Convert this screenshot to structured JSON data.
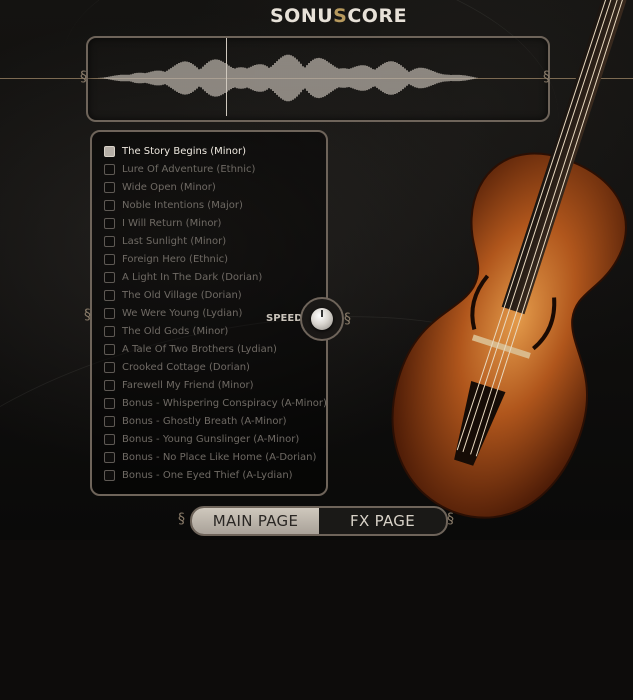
{
  "brand": {
    "logo_main": "SONU",
    "logo_s": "S",
    "logo_end": "CORE"
  },
  "presets": [
    {
      "label": "The Story Begins (Minor)",
      "selected": true
    },
    {
      "label": "Lure Of Adventure (Ethnic)",
      "selected": false
    },
    {
      "label": "Wide Open (Minor)",
      "selected": false
    },
    {
      "label": "Noble Intentions (Major)",
      "selected": false
    },
    {
      "label": "I Will Return (Minor)",
      "selected": false
    },
    {
      "label": "Last Sunlight (Minor)",
      "selected": false
    },
    {
      "label": "Foreign Hero (Ethnic)",
      "selected": false
    },
    {
      "label": "A Light In The Dark (Dorian)",
      "selected": false
    },
    {
      "label": "The Old Village (Dorian)",
      "selected": false
    },
    {
      "label": "We Were Young (Lydian)",
      "selected": false
    },
    {
      "label": "The Old Gods (Minor)",
      "selected": false
    },
    {
      "label": "A Tale Of Two Brothers (Lydian)",
      "selected": false
    },
    {
      "label": "Crooked Cottage (Dorian)",
      "selected": false
    },
    {
      "label": "Farewell My Friend (Minor)",
      "selected": false
    },
    {
      "label": "Bonus - Whispering Conspiracy (A-Minor)",
      "selected": false
    },
    {
      "label": "Bonus - Ghostly Breath (A-Minor)",
      "selected": false
    },
    {
      "label": "Bonus - Young Gunslinger (A-Minor)",
      "selected": false
    },
    {
      "label": "Bonus - No Place Like Home (A-Dorian)",
      "selected": false
    },
    {
      "label": "Bonus - One Eyed Thief (A-Lydian)",
      "selected": false
    }
  ],
  "speed": {
    "label": "SPEED"
  },
  "tabs": {
    "main": "MAIN PAGE",
    "fx": "FX PAGE"
  },
  "colors": {
    "accent": "#b89a5e",
    "frame": "#6e645a",
    "text": "#6f6a64"
  }
}
